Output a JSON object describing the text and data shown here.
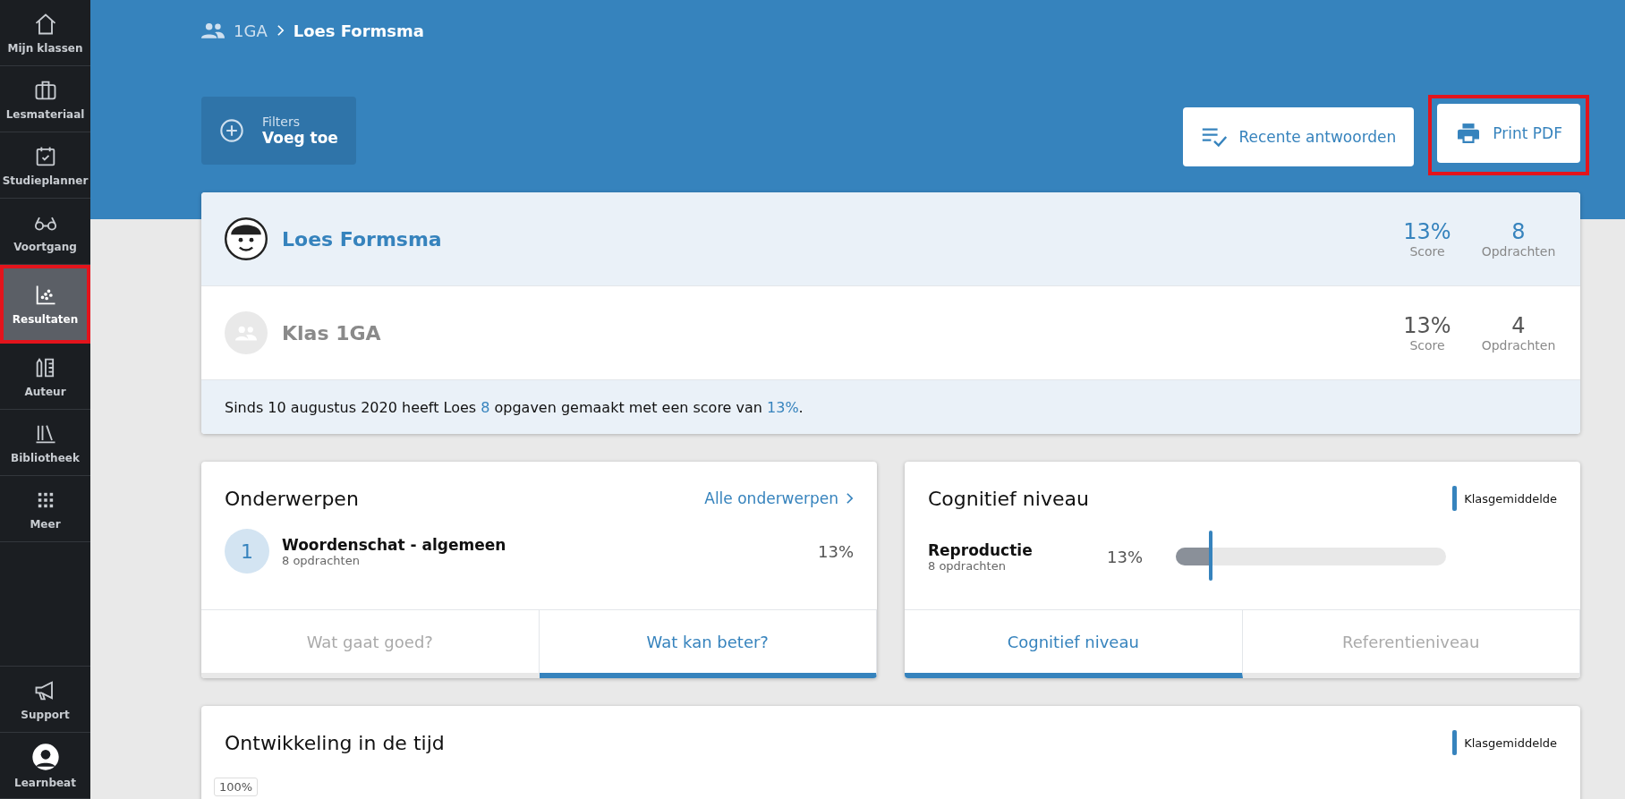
{
  "sidebar": {
    "items": [
      {
        "label": "Mijn klassen",
        "selected": false,
        "highlighted": false
      },
      {
        "label": "Lesmateriaal",
        "selected": false,
        "highlighted": false
      },
      {
        "label": "Studieplanner",
        "selected": false,
        "highlighted": false
      },
      {
        "label": "Voortgang",
        "selected": false,
        "highlighted": false
      },
      {
        "label": "Resultaten",
        "selected": true,
        "highlighted": true
      },
      {
        "label": "Auteur",
        "selected": false,
        "highlighted": false
      },
      {
        "label": "Bibliotheek",
        "selected": false,
        "highlighted": false
      },
      {
        "label": "Meer",
        "selected": false,
        "highlighted": false
      }
    ],
    "bottom": [
      {
        "label": "Support"
      },
      {
        "label": "Learnbeat"
      }
    ]
  },
  "breadcrumb": {
    "group": "1GA",
    "current": "Loes Formsma"
  },
  "filters": {
    "label": "Filters",
    "action": "Voeg toe"
  },
  "actions": [
    {
      "label": "Recente antwoorden",
      "highlighted": false
    },
    {
      "label": "Print PDF",
      "highlighted": true
    }
  ],
  "summary": {
    "rows": [
      {
        "kind": "student",
        "name": "Loes Formsma",
        "score": "13%",
        "score_label": "Score",
        "count": "8",
        "count_label": "Opdrachten"
      },
      {
        "kind": "class",
        "name": "Klas 1GA",
        "score": "13%",
        "score_label": "Score",
        "count": "4",
        "count_label": "Opdrachten"
      }
    ],
    "sentence": [
      {
        "text": "Sinds 10 augustus 2020 heeft Loes ",
        "accent": false
      },
      {
        "text": "8",
        "accent": true
      },
      {
        "text": " opgaven gemaakt met een score van ",
        "accent": false
      },
      {
        "text": "13%",
        "accent": true
      },
      {
        "text": ".",
        "accent": false
      }
    ]
  },
  "topics": {
    "title": "Onderwerpen",
    "link": "Alle onderwerpen",
    "items": [
      {
        "rank": "1",
        "name": "Woordenschat - algemeen",
        "count": "8 opdrachten",
        "score": "13%"
      }
    ],
    "tabs": [
      {
        "label": "Wat gaat goed?",
        "selected": false
      },
      {
        "label": "Wat kan beter?",
        "selected": true
      }
    ]
  },
  "cognitive": {
    "title": "Cognitief niveau",
    "legend": "Klasgemiddelde",
    "items": [
      {
        "name": "Reproductie",
        "count": "8 opdrachten",
        "score": "13%",
        "level": 0.13,
        "class_average": {
          "level": 0.13
        }
      }
    ],
    "tabs": [
      {
        "label": "Cognitief niveau",
        "selected": true
      },
      {
        "label": "Referentieniveau",
        "selected": false
      }
    ]
  },
  "development": {
    "title": "Ontwikkeling in de tijd",
    "legend": "Klasgemiddelde",
    "y_tick": "100%"
  }
}
